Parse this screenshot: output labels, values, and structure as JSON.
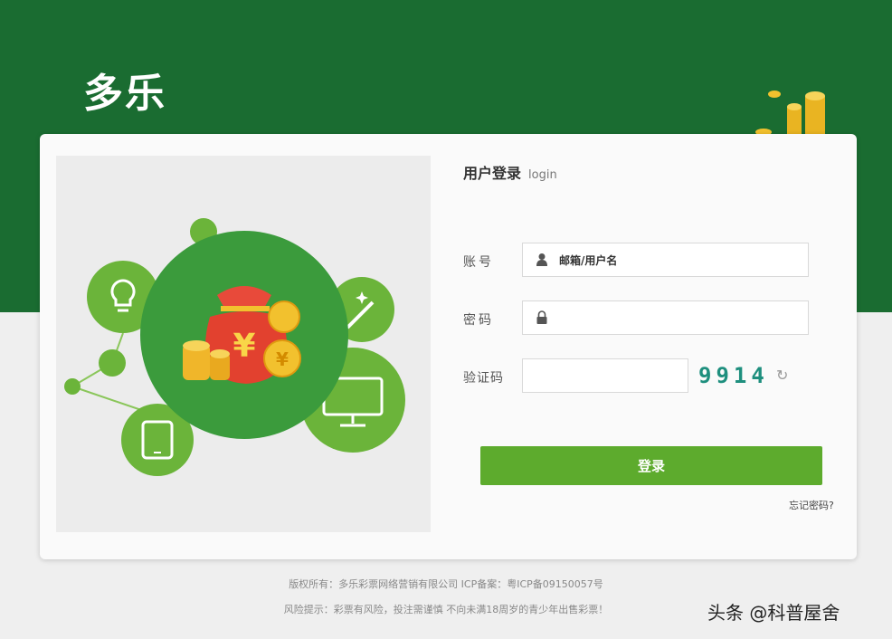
{
  "header": {
    "logo_text": "多乐"
  },
  "login": {
    "title": "用户登录",
    "subtitle": "login",
    "account_label": "账号",
    "account_value": "邮箱/用户名",
    "password_label": "密码",
    "password_value": "",
    "captcha_label": "验证码",
    "captcha_value": "",
    "captcha_code": "9914",
    "submit_label": "登录",
    "forgot_label": "忘记密码?"
  },
  "footer": {
    "copyright": "版权所有：多乐彩票网络营销有限公司 ICP备案：粤ICP备09150057号",
    "notice": "风险提示：彩票有风险，投注需谨慎 不向未满18周岁的青少年出售彩票！"
  },
  "watermark": "头条 @科普屋舍",
  "colors": {
    "brand_green": "#1a6c31",
    "button_green": "#5dab2d",
    "captcha_teal": "#1e8f7e"
  },
  "icons": [
    "user-icon",
    "lock-icon",
    "refresh-icon",
    "lightbulb-icon",
    "tablet-icon",
    "monitor-icon",
    "wand-icon",
    "money-bag-icon",
    "gold-coins-icon"
  ]
}
